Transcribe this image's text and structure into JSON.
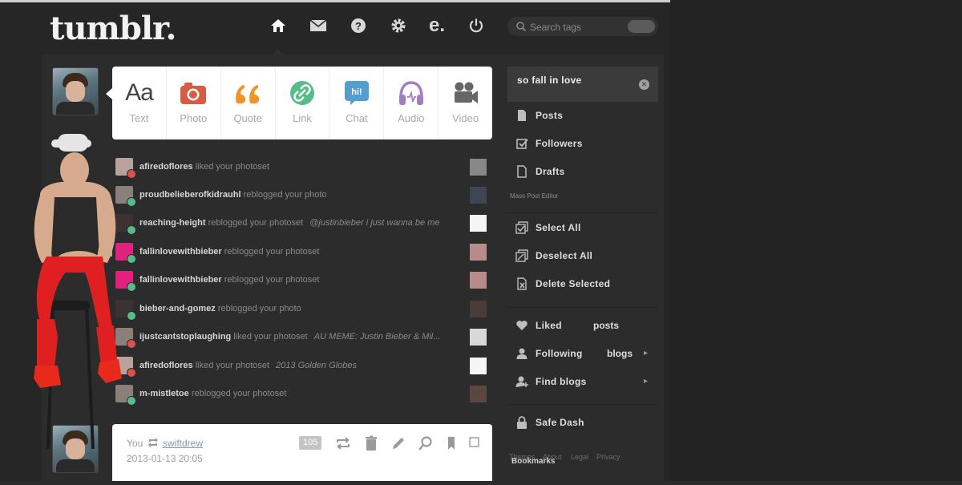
{
  "header": {
    "logo": "tumblr.",
    "nav": [
      {
        "icon": "home-icon",
        "active": true
      },
      {
        "icon": "mail-icon"
      },
      {
        "icon": "help-icon"
      },
      {
        "icon": "gear-icon"
      },
      {
        "icon": "e-icon",
        "text": "e."
      },
      {
        "icon": "power-icon"
      }
    ],
    "search_placeholder": "Search tags"
  },
  "post_types": [
    {
      "label": "Text",
      "glyph": "Aa",
      "icon": "text-icon"
    },
    {
      "label": "Photo",
      "icon": "camera-icon",
      "color": "#d95b43"
    },
    {
      "label": "Quote",
      "glyph": "“",
      "icon": "quote-icon",
      "color": "#f0932b"
    },
    {
      "label": "Link",
      "icon": "link-icon",
      "color": "#56bc8a"
    },
    {
      "label": "Chat",
      "glyph": "hi!",
      "icon": "chat-icon",
      "color": "#529ecc"
    },
    {
      "label": "Audio",
      "icon": "headphones-icon",
      "color": "#a77dc2"
    },
    {
      "label": "Video",
      "icon": "video-camera-icon",
      "color": "#666666"
    }
  ],
  "activity": [
    {
      "user": "afiredoflores",
      "action": "liked your photoset",
      "note": "",
      "type": "heart"
    },
    {
      "user": "proudbelieberofkidrauhl",
      "action": "reblogged your photo",
      "note": "",
      "type": "reblog"
    },
    {
      "user": "reaching-height",
      "action": "reblogged your photoset",
      "note": "@justinbieber i just wanna be me",
      "type": "reblog"
    },
    {
      "user": "fallinlovewithbieber",
      "action": "reblogged your photoset",
      "note": "",
      "type": "reblog"
    },
    {
      "user": "fallinlovewithbieber",
      "action": "reblogged your photoset",
      "note": "",
      "type": "reblog"
    },
    {
      "user": "bieber-and-gomez",
      "action": "reblogged your photo",
      "note": "",
      "type": "reblog"
    },
    {
      "user": "ijustcantstoplaughing",
      "action": "liked your photoset",
      "note": "AU MEME: Justin Bieber & Mil...",
      "type": "heart"
    },
    {
      "user": "afiredoflores",
      "action": "liked your photoset",
      "note": "2013 Golden Globes",
      "type": "heart"
    },
    {
      "user": "m-mistletoe",
      "action": "reblogged your photoset",
      "note": "",
      "type": "reblog"
    }
  ],
  "post": {
    "you": "You",
    "reblogged_from": "swiftdrew",
    "date": "2013-01-13 20:05",
    "notes": "105"
  },
  "sidebar": {
    "blog_name": "so fall in love",
    "items": [
      {
        "label": "Posts",
        "icon": "document-icon"
      },
      {
        "label": "Followers",
        "icon": "followers-icon"
      },
      {
        "label": "Drafts",
        "icon": "drafts-icon"
      }
    ],
    "mass_editor": "Mass Post Editor",
    "mass_items": [
      {
        "label": "Select All",
        "icon": "select-all-icon"
      },
      {
        "label": "Deselect All",
        "icon": "deselect-all-icon"
      },
      {
        "label": "Delete Selected",
        "icon": "delete-selected-icon"
      }
    ],
    "liked": {
      "label": "Liked",
      "label2": "posts"
    },
    "following": {
      "label": "Following",
      "label2": "blogs"
    },
    "find_blogs": {
      "label": "Find blogs"
    },
    "safe_dash": {
      "label": "Safe Dash"
    },
    "footer": [
      "Themes",
      "About",
      "Legal",
      "Privacy"
    ],
    "bookmarks": "Bookmarks"
  }
}
